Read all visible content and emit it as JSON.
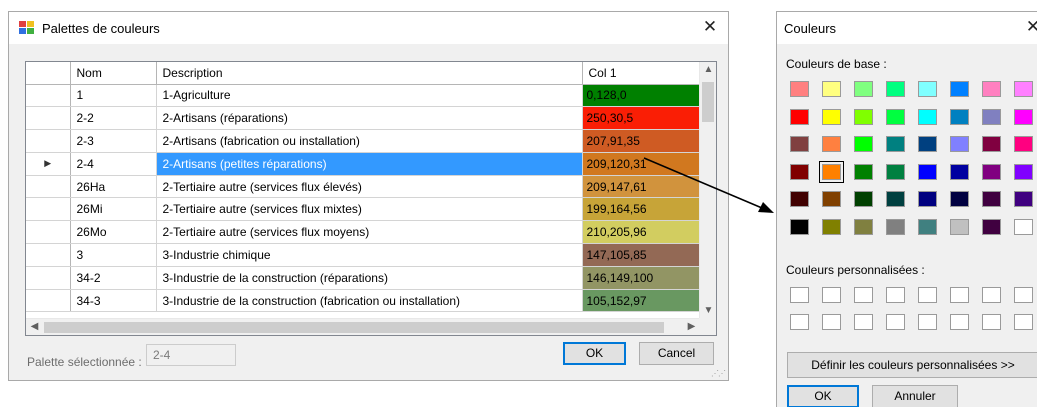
{
  "palette_dialog": {
    "title": "Palettes de couleurs",
    "close_glyph": "✕",
    "columns": [
      "Nom",
      "Description",
      "Col 1"
    ],
    "rows": [
      {
        "nom": "1",
        "description": "1-Agriculture",
        "col1": "0,128,0",
        "color": "#008000"
      },
      {
        "nom": "2-2",
        "description": "2-Artisans (réparations)",
        "col1": "250,30,5",
        "color": "#fa1e05"
      },
      {
        "nom": "2-3",
        "description": "2-Artisans (fabrication ou installation)",
        "col1": "207,91,35",
        "color": "#cf5b23"
      },
      {
        "nom": "2-4",
        "description": "2-Artisans (petites réparations)",
        "col1": "209,120,31",
        "color": "#d1781f",
        "selected": true
      },
      {
        "nom": "26Ha",
        "description": "2-Tertiaire autre (services flux élevés)",
        "col1": "209,147,61",
        "color": "#d1933d"
      },
      {
        "nom": "26Mi",
        "description": "2-Tertiaire autre (services flux mixtes)",
        "col1": "199,164,56",
        "color": "#c7a438"
      },
      {
        "nom": "26Mo",
        "description": "2-Tertiaire autre (services flux moyens)",
        "col1": "210,205,96",
        "color": "#d2cd60"
      },
      {
        "nom": "3",
        "description": "3-Industrie chimique",
        "col1": "147,105,85",
        "color": "#936955"
      },
      {
        "nom": "34-2",
        "description": "3-Industrie de la construction (réparations)",
        "col1": "146,149,100",
        "color": "#929564"
      },
      {
        "nom": "34-3",
        "description": "3-Industrie de la construction (fabrication ou installation)",
        "col1": "105,152,97",
        "color": "#699861"
      }
    ],
    "selected_palette_label": "Palette sélectionnée :",
    "selected_palette_value": "2-4",
    "ok_label": "OK",
    "cancel_label": "Cancel"
  },
  "color_dialog": {
    "title": "Couleurs",
    "close_glyph": "✕",
    "basic_colors_label": "Couleurs de base :",
    "basic_colors": [
      [
        "#ff8080",
        "#ffff80",
        "#80ff80",
        "#00ff80",
        "#80ffff",
        "#0080ff",
        "#ff80c0",
        "#ff80ff"
      ],
      [
        "#ff0000",
        "#ffff00",
        "#80ff00",
        "#00ff40",
        "#00ffff",
        "#0080c0",
        "#8080c0",
        "#ff00ff"
      ],
      [
        "#804040",
        "#ff8040",
        "#00ff00",
        "#008080",
        "#004080",
        "#8080ff",
        "#800040",
        "#ff0080"
      ],
      [
        "#800000",
        "#ff8000",
        "#008000",
        "#008040",
        "#0000ff",
        "#0000a0",
        "#800080",
        "#8000ff"
      ],
      [
        "#400000",
        "#804000",
        "#004000",
        "#004040",
        "#000080",
        "#000040",
        "#400040",
        "#400080"
      ],
      [
        "#000000",
        "#808000",
        "#808040",
        "#808080",
        "#408080",
        "#c0c0c0",
        "#400040",
        "#ffffff"
      ]
    ],
    "selected_basic": [
      3,
      1
    ],
    "custom_colors_label": "Couleurs personnalisées :",
    "custom_rows": 2,
    "custom_cols": 8,
    "define_button_label": "Définir les couleurs personnalisées >>",
    "ok_label": "OK",
    "cancel_label": "Annuler"
  }
}
